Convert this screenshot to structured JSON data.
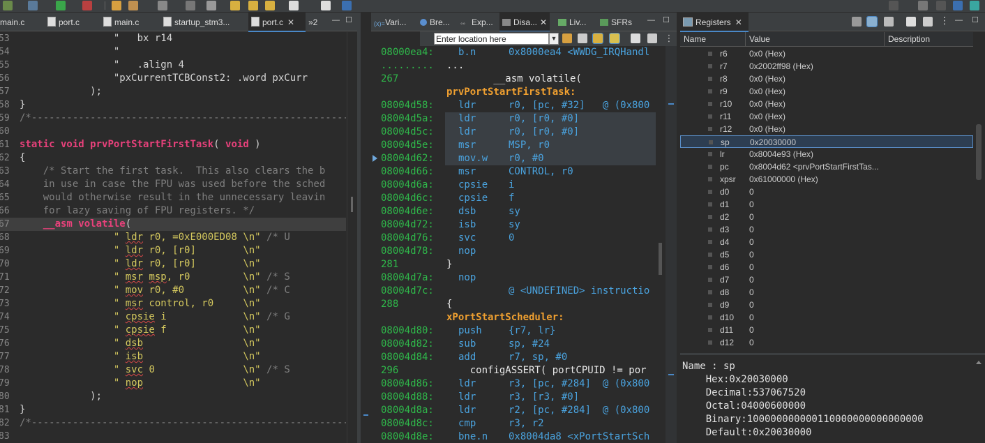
{
  "editor": {
    "tabs": [
      {
        "label": "main.c",
        "active": false
      },
      {
        "label": "port.c",
        "active": false
      },
      {
        "label": "main.c",
        "active": false
      },
      {
        "label": "startup_stm3...",
        "active": false
      },
      {
        "label": "port.c",
        "active": true
      }
    ],
    "overflow_label": "»2",
    "lines": [
      {
        "n": "53",
        "text": "                \"   bx r14"
      },
      {
        "n": "54",
        "text": "                \""
      },
      {
        "n": "55",
        "text": "                \"   .align 4"
      },
      {
        "n": "56",
        "text": "                \"pxCurrentTCBConst2: .word pxCurr"
      },
      {
        "n": "57",
        "text": "            );"
      },
      {
        "n": "58",
        "text": "}"
      },
      {
        "n": "59",
        "text": "/*-------------------------------------------------------"
      },
      {
        "n": "60",
        "text": ""
      },
      {
        "n": "61",
        "kw1": "static void ",
        "fn": "prvPortStartFirstTask",
        "mid": "( ",
        "kw2": "void",
        "tail": " )"
      },
      {
        "n": "62",
        "text": "{"
      },
      {
        "n": "63",
        "cmt": "    /* Start the first task.  This also clears the b"
      },
      {
        "n": "64",
        "cmt": "    in use in case the FPU was used before the sched"
      },
      {
        "n": "65",
        "cmt": "    would otherwise result in the unnecessary leavin"
      },
      {
        "n": "66",
        "cmt": "    for lazy saving of FPU registers. */"
      },
      {
        "n": "67",
        "asm": "    __asm volatile",
        "tail": "("
      },
      {
        "n": "68",
        "q": "\" ",
        "ins": "ldr",
        "rest": " r0, =0xE000ED08",
        "nl": "\\n\"",
        "c": " /* U"
      },
      {
        "n": "69",
        "q": "\" ",
        "ins": "ldr",
        "rest": " r0, [r0]",
        "nl": "\\n\"",
        "c": ""
      },
      {
        "n": "70",
        "q": "\" ",
        "ins": "ldr",
        "rest": " r0, [r0]",
        "nl": "\\n\"",
        "c": ""
      },
      {
        "n": "71",
        "q": "\" ",
        "ins": "msr",
        "rest": " ",
        "ins2": "msp",
        "rest2": ", r0",
        "nl": "\\n\"",
        "c": " /* S"
      },
      {
        "n": "72",
        "q": "\" ",
        "ins": "mov",
        "rest": " r0, #0",
        "nl": "\\n\"",
        "c": " /* C"
      },
      {
        "n": "73",
        "q": "\" ",
        "ins": "msr",
        "rest": " control, r0",
        "nl": "\\n\"",
        "c": ""
      },
      {
        "n": "74",
        "q": "\" ",
        "ins": "cpsie",
        "rest": " i",
        "nl": "\\n\"",
        "c": " /* G"
      },
      {
        "n": "75",
        "q": "\" ",
        "ins": "cpsie",
        "rest": " f",
        "nl": "\\n\"",
        "c": ""
      },
      {
        "n": "76",
        "q": "\" ",
        "ins": "dsb",
        "rest": "",
        "nl": "\\n\"",
        "c": ""
      },
      {
        "n": "77",
        "q": "\" ",
        "ins": "isb",
        "rest": "",
        "nl": "\\n\"",
        "c": ""
      },
      {
        "n": "78",
        "q": "\" ",
        "ins": "svc",
        "rest": " 0",
        "nl": "\\n\"",
        "c": " /* S"
      },
      {
        "n": "79",
        "q": "\" ",
        "ins": "nop",
        "rest": "",
        "nl": "\\n\"",
        "c": ""
      },
      {
        "n": "80",
        "text": "            );"
      },
      {
        "n": "81",
        "text": "}"
      },
      {
        "n": "82",
        "text": "/*-------------------------------------------------------"
      },
      {
        "n": "83",
        "text": ""
      }
    ]
  },
  "disasm": {
    "tabs": [
      {
        "label": "Vari..."
      },
      {
        "label": "Bre..."
      },
      {
        "label": "Exp..."
      },
      {
        "label": "Disa...",
        "active": true
      },
      {
        "label": "Liv..."
      },
      {
        "label": "SFRs"
      }
    ],
    "location_placeholder": "Enter location here",
    "lines": [
      {
        "kind": "ins",
        "addr": "08000ea4:",
        "m": "b.n",
        "o": "0x8000ea4 <WWDG_IRQHandl"
      },
      {
        "kind": "src",
        "addr": ".........",
        "src": "..."
      },
      {
        "kind": "srcnum",
        "addr": "267",
        "src": "        __asm volatile("
      },
      {
        "kind": "fn",
        "addr": "",
        "src": "prvPortStartFirstTask:"
      },
      {
        "kind": "ins",
        "addr": "08004d58:",
        "m": "ldr",
        "o": "r0, [pc, #32]   @ (0x800"
      },
      {
        "kind": "ins",
        "addr": "08004d5a:",
        "m": "ldr",
        "o": "r0, [r0, #0]",
        "hl": true
      },
      {
        "kind": "ins",
        "addr": "08004d5c:",
        "m": "ldr",
        "o": "r0, [r0, #0]",
        "hl": true
      },
      {
        "kind": "ins",
        "addr": "08004d5e:",
        "m": "msr",
        "o": "MSP, r0",
        "hl": true
      },
      {
        "kind": "ins",
        "addr": "08004d62:",
        "m": "mov.w",
        "o": "r0, #0",
        "hl": true,
        "pc": true
      },
      {
        "kind": "ins",
        "addr": "08004d66:",
        "m": "msr",
        "o": "CONTROL, r0"
      },
      {
        "kind": "ins",
        "addr": "08004d6a:",
        "m": "cpsie",
        "o": "i"
      },
      {
        "kind": "ins",
        "addr": "08004d6c:",
        "m": "cpsie",
        "o": "f"
      },
      {
        "kind": "ins",
        "addr": "08004d6e:",
        "m": "dsb",
        "o": "sy"
      },
      {
        "kind": "ins",
        "addr": "08004d72:",
        "m": "isb",
        "o": "sy"
      },
      {
        "kind": "ins",
        "addr": "08004d76:",
        "m": "svc",
        "o": "0"
      },
      {
        "kind": "ins",
        "addr": "08004d78:",
        "m": "nop",
        "o": ""
      },
      {
        "kind": "srcnum",
        "addr": "281",
        "src": "}"
      },
      {
        "kind": "ins",
        "addr": "08004d7a:",
        "m": "nop",
        "o": ""
      },
      {
        "kind": "ins",
        "addr": "08004d7c:",
        "m": "",
        "o": "@ <UNDEFINED> instructio"
      },
      {
        "kind": "srcnum",
        "addr": "288",
        "src": "{"
      },
      {
        "kind": "fn",
        "addr": "",
        "src": "xPortStartScheduler:"
      },
      {
        "kind": "ins",
        "addr": "08004d80:",
        "m": "push",
        "o": "{r7, lr}"
      },
      {
        "kind": "ins",
        "addr": "08004d82:",
        "m": "sub",
        "o": "sp, #24"
      },
      {
        "kind": "ins",
        "addr": "08004d84:",
        "m": "add",
        "o": "r7, sp, #0"
      },
      {
        "kind": "srcnum",
        "addr": "296",
        "src": "    configASSERT( portCPUID != por"
      },
      {
        "kind": "ins",
        "addr": "08004d86:",
        "m": "ldr",
        "o": "r3, [pc, #284]  @ (0x800"
      },
      {
        "kind": "ins",
        "addr": "08004d88:",
        "m": "ldr",
        "o": "r3, [r3, #0]"
      },
      {
        "kind": "ins",
        "addr": "08004d8a:",
        "m": "ldr",
        "o": "r2, [pc, #284]  @ (0x800"
      },
      {
        "kind": "ins",
        "addr": "08004d8c:",
        "m": "cmp",
        "o": "r3, r2"
      },
      {
        "kind": "ins",
        "addr": "08004d8e:",
        "m": "bne.n",
        "o": "0x8004da8 <xPortStartSch"
      }
    ]
  },
  "registers": {
    "tab_label": "Registers",
    "columns": [
      "Name",
      "Value",
      "Description"
    ],
    "rows": [
      {
        "name": "r6",
        "value": "0x0 (Hex)"
      },
      {
        "name": "r7",
        "value": "0x2002ff98 (Hex)"
      },
      {
        "name": "r8",
        "value": "0x0 (Hex)"
      },
      {
        "name": "r9",
        "value": "0x0 (Hex)"
      },
      {
        "name": "r10",
        "value": "0x0 (Hex)"
      },
      {
        "name": "r11",
        "value": "0x0 (Hex)"
      },
      {
        "name": "r12",
        "value": "0x0 (Hex)"
      },
      {
        "name": "sp",
        "value": "0x20030000",
        "selected": true
      },
      {
        "name": "lr",
        "value": "0x8004e93 (Hex)"
      },
      {
        "name": "pc",
        "value": "0x8004d62 <prvPortStartFirstTas..."
      },
      {
        "name": "xpsr",
        "value": "0x61000000 (Hex)"
      },
      {
        "name": "d0",
        "value": "0"
      },
      {
        "name": "d1",
        "value": "0"
      },
      {
        "name": "d2",
        "value": "0"
      },
      {
        "name": "d3",
        "value": "0"
      },
      {
        "name": "d4",
        "value": "0"
      },
      {
        "name": "d5",
        "value": "0"
      },
      {
        "name": "d6",
        "value": "0"
      },
      {
        "name": "d7",
        "value": "0"
      },
      {
        "name": "d8",
        "value": "0"
      },
      {
        "name": "d9",
        "value": "0"
      },
      {
        "name": "d10",
        "value": "0"
      },
      {
        "name": "d11",
        "value": "0"
      },
      {
        "name": "d12",
        "value": "0"
      }
    ],
    "detail": [
      "Name : sp",
      "    Hex:0x20030000",
      "    Decimal:537067520",
      "    Octal:04000600000",
      "    Binary:100000000000110000000000000000",
      "    Default:0x20030000"
    ]
  }
}
